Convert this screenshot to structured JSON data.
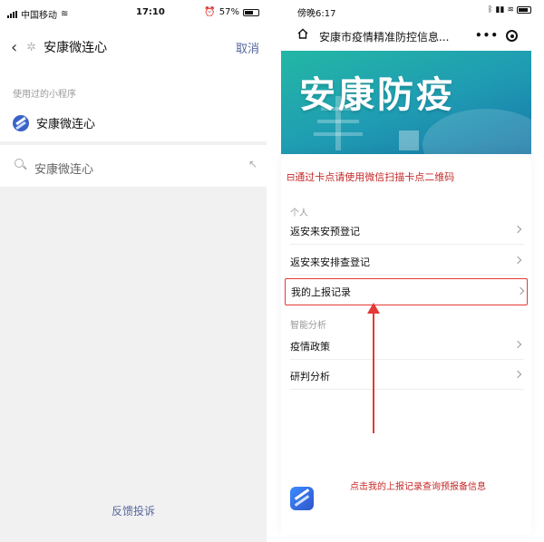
{
  "left": {
    "status": {
      "carrier": "中国移动",
      "time": "17:10",
      "battery": "57%"
    },
    "nav": {
      "title": "安康微连心",
      "cancel": "取消"
    },
    "used_header": "使用过的小程序",
    "used_item": "安康微连心",
    "search_value": "安康微连心",
    "feedback": "反馈投诉"
  },
  "right": {
    "status": {
      "time": "傍晚6:17"
    },
    "nav": {
      "title": "安康市疫情精准防控信息...",
      "more": "•••"
    },
    "banner_title": "安康防疫",
    "notice": "通过卡点请使用微信扫描卡点二维码",
    "section_personal": "个人",
    "items_personal": [
      "返安来安预登记",
      "返安来安排查登记",
      "我的上报记录"
    ],
    "section_analysis": "智能分析",
    "items_analysis": [
      "疫情政策",
      "研判分析"
    ],
    "hint": "点击我的上报记录查询预报备信息"
  },
  "colors": {
    "link": "#57679e",
    "alert": "#c62828",
    "accent": "#e53935",
    "banner": "#23b7a5"
  },
  "icons": [
    "back-arrow-icon",
    "star-icon",
    "app-icon",
    "search-icon",
    "fill-arrow-icon",
    "home-icon",
    "more-icon",
    "close-icon",
    "chevron-right-icon"
  ]
}
